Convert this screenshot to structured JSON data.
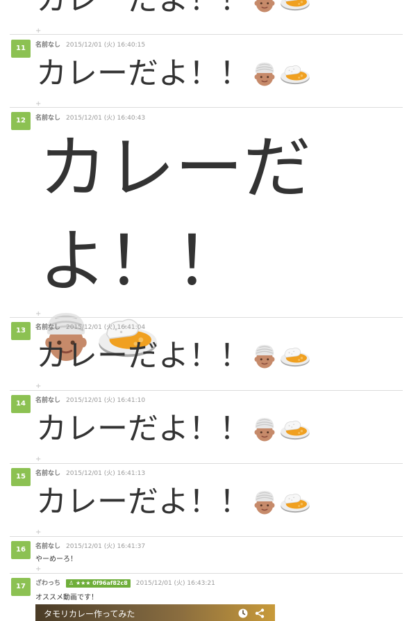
{
  "posts": [
    {
      "num": "",
      "name": "",
      "date": "",
      "text": "カレーだよ！！"
    },
    {
      "num": "11",
      "name": "名前なし",
      "date": "2015/12/01 (火) 16:40:15",
      "text": "カレーだよ！！"
    },
    {
      "num": "12",
      "name": "名前なし",
      "date": "2015/12/01 (火) 16:40:43",
      "text": "カレーだよ！！"
    },
    {
      "num": "13",
      "name": "名前なし",
      "date": "2015/12/01 (火) 16:41:04",
      "text": "カレーだよ！！"
    },
    {
      "num": "14",
      "name": "名前なし",
      "date": "2015/12/01 (火) 16:41:10",
      "text": "カレーだよ！！"
    },
    {
      "num": "15",
      "name": "名前なし",
      "date": "2015/12/01 (火) 16:41:13",
      "text": "カレーだよ！！"
    },
    {
      "num": "16",
      "name": "名前なし",
      "date": "2015/12/01 (火) 16:41:37",
      "text": "やーめーろ！"
    },
    {
      "num": "17",
      "name": "ざわっち",
      "badge": "★★★ 0f96af82c8",
      "date": "2015/12/01 (火) 16:43:21",
      "text": "オススメ動画です！"
    }
  ],
  "plus_label": "+",
  "video": {
    "title": "タモリカレー作ってみた",
    "icons": [
      "clock-icon",
      "share-icon"
    ]
  },
  "colors": {
    "accent": "#8cc152",
    "badge": "#6fae3a"
  },
  "emoji": [
    "turban-man-emoji",
    "curry-rice-emoji"
  ]
}
